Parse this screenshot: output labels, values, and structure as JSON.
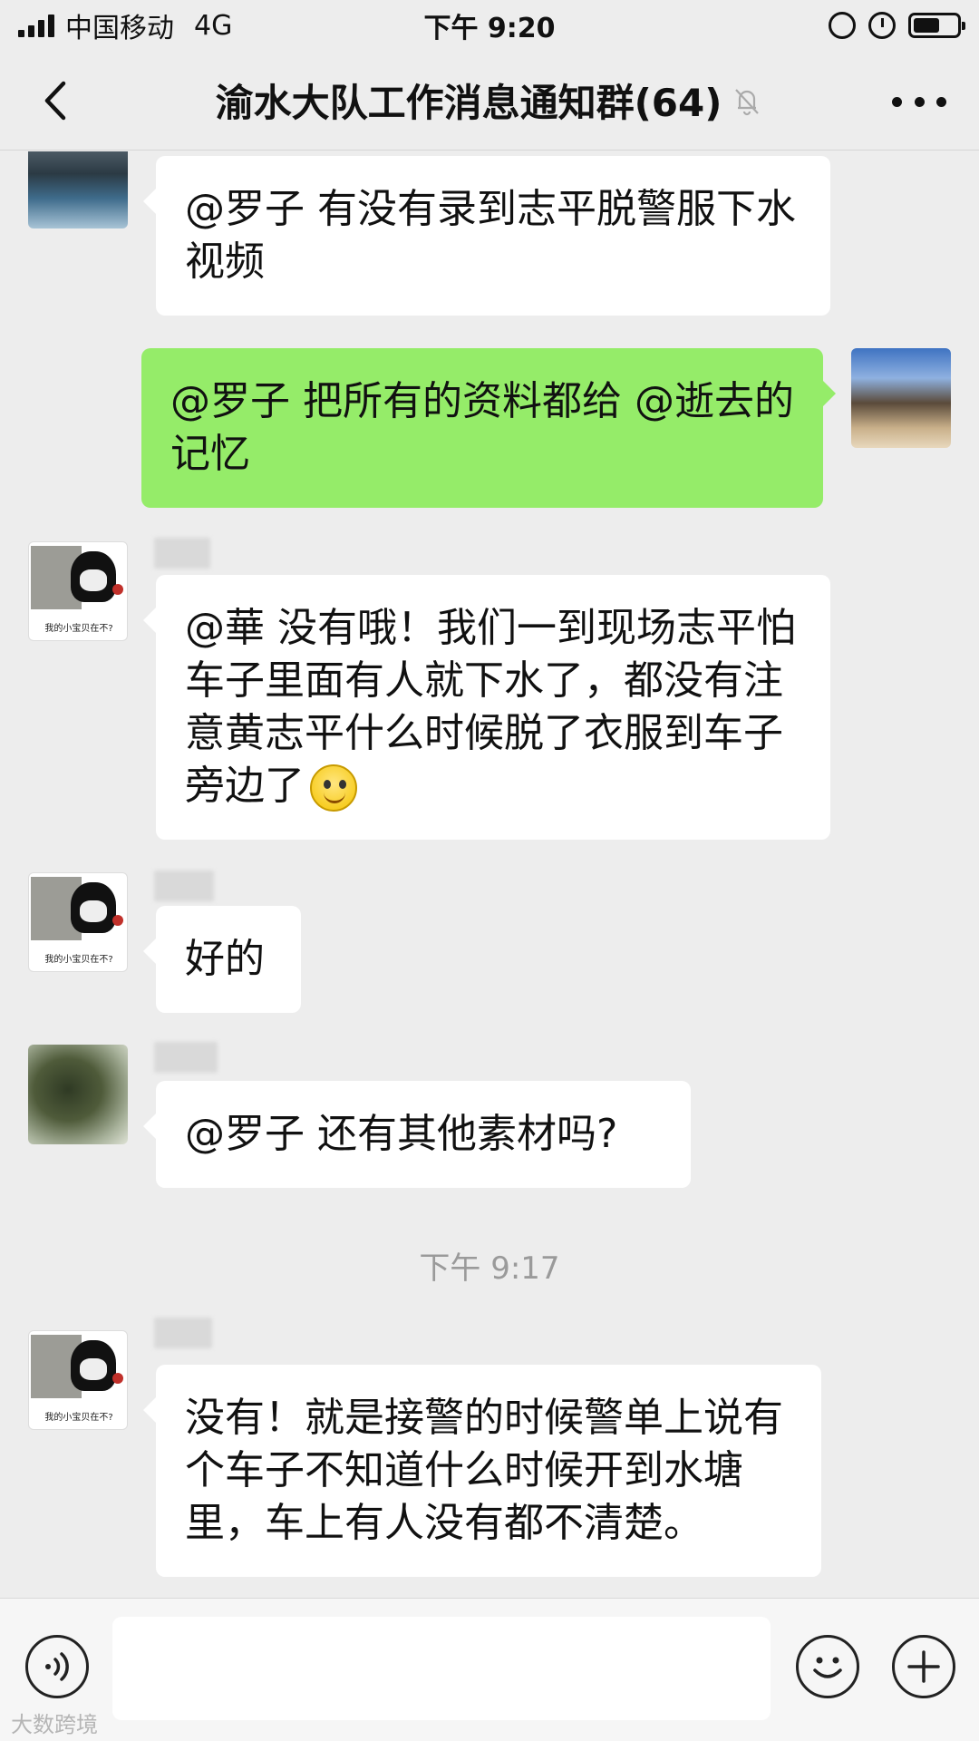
{
  "status_bar": {
    "carrier": "中国移动",
    "network": "4G",
    "time": "下午 9:20",
    "battery_level": 0.6
  },
  "nav": {
    "title": "渝水大队工作消息通知群(64)",
    "back_icon": "chevron-left-icon",
    "mute_icon": "bell-off-icon",
    "more_icon": "more-dots-icon"
  },
  "messages": [
    {
      "side": "left",
      "text": "@罗子 有没有录到志平脱警服下水视频"
    },
    {
      "side": "right",
      "text": "@罗子 把所有的资料都给 @逝去的记忆"
    },
    {
      "side": "left",
      "text": "@華 没有哦！我们一到现场志平怕车子里面有人就下水了，都没有注意黄志平什么时候脱了衣服到车子旁边了"
    },
    {
      "side": "left",
      "text": "好的"
    },
    {
      "side": "left",
      "text": "@罗子 还有其他素材吗?"
    },
    {
      "side": "left",
      "text": "没有！就是接警的时候警单上说有个车子不知道什么时候开到水塘里，车上有人没有都不清楚。"
    }
  ],
  "avatar_caption": "我的小宝贝在不?",
  "timestamp": "下午 9:17",
  "input": {
    "placeholder": "",
    "voice_icon": "voice-icon",
    "emoji_icon": "emoji-icon",
    "plus_icon": "plus-icon"
  },
  "watermark": "大数跨境",
  "colors": {
    "background": "#ededed",
    "self_bubble": "#95ec69",
    "other_bubble": "#ffffff"
  }
}
